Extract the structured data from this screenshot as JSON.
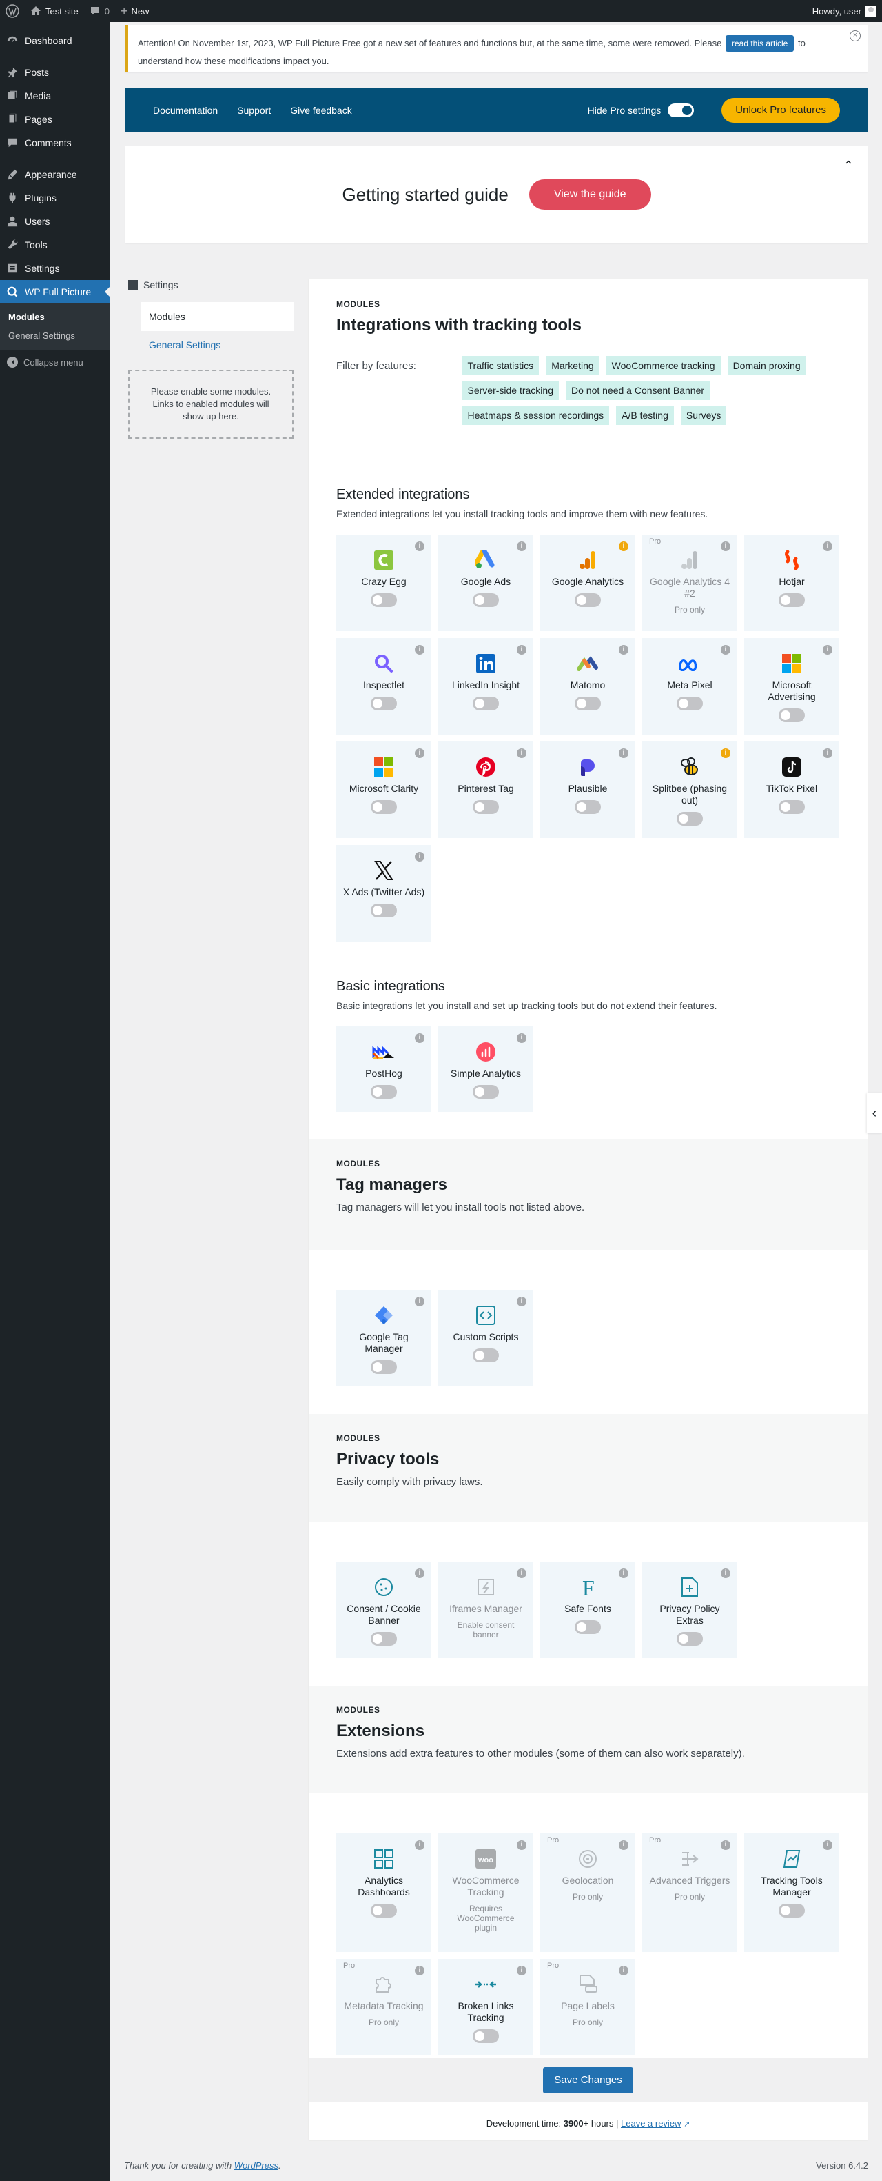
{
  "adminbar": {
    "site": "Test site",
    "comments": "0",
    "new": "New",
    "howdy": "Howdy, user"
  },
  "sidebar": {
    "items": [
      "Dashboard",
      "Posts",
      "Media",
      "Pages",
      "Comments",
      "Appearance",
      "Plugins",
      "Users",
      "Tools",
      "Settings",
      "WP Full Picture"
    ],
    "sub": [
      "Modules",
      "General Settings"
    ],
    "collapse": "Collapse menu"
  },
  "notice": {
    "text1": "Attention! On November 1st, 2023, WP Full Picture Free got a new set of features and functions but, at the same time, some were removed. Please",
    "button": "read this article",
    "text2": "to understand how these modifications impact you.",
    "close": "×"
  },
  "topnav": {
    "links": [
      "Documentation",
      "Support",
      "Give feedback"
    ],
    "hide_pro": "Hide Pro settings",
    "unlock": "Unlock Pro features"
  },
  "guide": {
    "title": "Getting started guide",
    "button": "View the guide",
    "chev": "⌃"
  },
  "leftcol": {
    "header": "Settings",
    "nav1": "Modules",
    "nav2": "General Settings",
    "empty": "Please enable some modules. Links to enabled modules will show up here."
  },
  "sections": {
    "s1": {
      "eyebrow": "MODULES",
      "title": "Integrations with tracking tools",
      "filter_label": "Filter by features:",
      "tags": [
        "Traffic statistics",
        "Marketing",
        "WooCommerce tracking",
        "Domain proxing",
        "Server-side tracking",
        "Do not need a Consent Banner",
        "Heatmaps & session recordings",
        "A/B testing",
        "Surveys"
      ]
    },
    "ext": {
      "title": "Extended integrations",
      "desc": "Extended integrations let you install tracking tools and improve them with new features."
    },
    "basic": {
      "title": "Basic integrations",
      "desc": "Basic integrations let you install and set up tracking tools but do not extend their features."
    },
    "tag": {
      "eyebrow": "MODULES",
      "title": "Tag managers",
      "desc": "Tag managers will let you install tools not listed above."
    },
    "priv": {
      "eyebrow": "MODULES",
      "title": "Privacy tools",
      "desc": "Easily comply with privacy laws."
    },
    "extn": {
      "eyebrow": "MODULES",
      "title": "Extensions",
      "desc": "Extensions add extra features to other modules (some of them can also work separately)."
    }
  },
  "cards": {
    "crazyegg": "Crazy Egg",
    "gads": "Google Ads",
    "ga": "Google Analytics",
    "ga4": "Google Analytics 4 #2",
    "hotjar": "Hotjar",
    "inspectlet": "Inspectlet",
    "linkedin": "LinkedIn Insight",
    "matomo": "Matomo",
    "meta": "Meta Pixel",
    "msads": "Microsoft Advertising",
    "clarity": "Microsoft Clarity",
    "pinterest": "Pinterest Tag",
    "plausible": "Plausible",
    "splitbee": "Splitbee (phasing out)",
    "tiktok": "TikTok Pixel",
    "xads": "X Ads (Twitter Ads)",
    "posthog": "PostHog",
    "simple": "Simple Analytics",
    "gtm": "Google Tag Manager",
    "custom": "Custom Scripts",
    "consent": "Consent / Cookie Banner",
    "iframes": "Iframes Manager",
    "fonts": "Safe Fonts",
    "privacy": "Privacy Policy Extras",
    "dash": "Analytics Dashboards",
    "woo": "WooCommerce Tracking",
    "geo": "Geolocation",
    "triggers": "Advanced Triggers",
    "ttm": "Tracking Tools Manager",
    "meta_track": "Metadata Tracking",
    "broken": "Broken Links Tracking",
    "labels": "Page Labels"
  },
  "notes": {
    "pro_only": "Pro only",
    "pro": "Pro",
    "enable_consent": "Enable consent banner",
    "requires_woo": "Requires WooCommerce plugin",
    "info": "i"
  },
  "save": {
    "label": "Save Changes"
  },
  "devtime": {
    "prefix": "Development time:",
    "hours": "3900+",
    "suffix": "hours |",
    "link": "Leave a review"
  },
  "footer": {
    "thanks": "Thank you for creating with",
    "wp": "WordPress",
    "dot": ".",
    "version": "Version 6.4.2"
  }
}
